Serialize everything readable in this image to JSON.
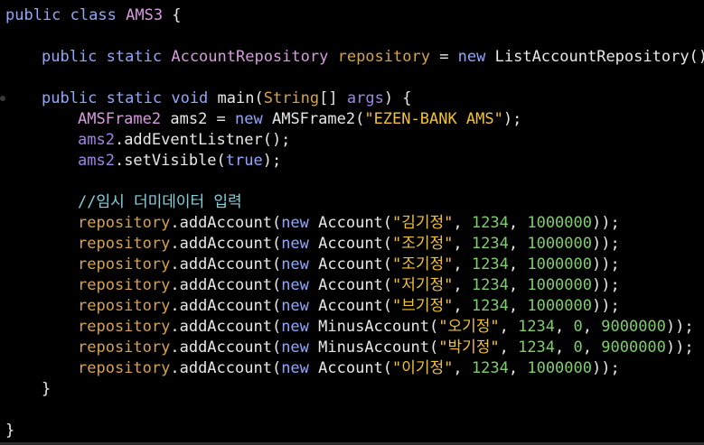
{
  "colors": {
    "background": "#000000",
    "plain": "#e8e8e8",
    "keyword": "#8fa7ff",
    "type": "#d99ae0",
    "field": "#d8a24b",
    "variable": "#9e86e6",
    "method": "#e6e6e6",
    "string": "#f2c230",
    "number": "#7ecf6b",
    "comment": "#80d4e0"
  },
  "icons": [
    "fold-marker-icon"
  ],
  "code_lines": [
    {
      "indent": 0,
      "tokens": [
        {
          "t": "public",
          "k": "keyword"
        },
        {
          "t": " ",
          "k": "plain"
        },
        {
          "t": "class",
          "k": "keyword"
        },
        {
          "t": " ",
          "k": "plain"
        },
        {
          "t": "AMS3",
          "k": "type"
        },
        {
          "t": " {",
          "k": "plain"
        }
      ]
    },
    {
      "indent": 0,
      "tokens": []
    },
    {
      "indent": 1,
      "tokens": [
        {
          "t": "public",
          "k": "keyword"
        },
        {
          "t": " ",
          "k": "plain"
        },
        {
          "t": "static",
          "k": "keyword"
        },
        {
          "t": " ",
          "k": "plain"
        },
        {
          "t": "AccountRepository",
          "k": "type"
        },
        {
          "t": " ",
          "k": "plain"
        },
        {
          "t": "repository",
          "k": "field"
        },
        {
          "t": " = ",
          "k": "plain"
        },
        {
          "t": "new",
          "k": "keyword"
        },
        {
          "t": " ListAccountRepository();",
          "k": "plain"
        }
      ]
    },
    {
      "indent": 0,
      "tokens": []
    },
    {
      "indent": 1,
      "fold": true,
      "tokens": [
        {
          "t": "public",
          "k": "keyword"
        },
        {
          "t": " ",
          "k": "plain"
        },
        {
          "t": "static",
          "k": "keyword"
        },
        {
          "t": " ",
          "k": "plain"
        },
        {
          "t": "void",
          "k": "keyword"
        },
        {
          "t": " main(",
          "k": "plain"
        },
        {
          "t": "String",
          "k": "field"
        },
        {
          "t": "[] ",
          "k": "plain"
        },
        {
          "t": "args",
          "k": "variable"
        },
        {
          "t": ") {",
          "k": "plain"
        }
      ]
    },
    {
      "indent": 2,
      "tokens": [
        {
          "t": "AMSFrame2",
          "k": "type"
        },
        {
          "t": " ams2 = ",
          "k": "plain"
        },
        {
          "t": "new",
          "k": "keyword"
        },
        {
          "t": " AMSFrame2(",
          "k": "plain"
        },
        {
          "t": "\"EZEN-BANK AMS\"",
          "k": "string"
        },
        {
          "t": ");",
          "k": "plain"
        }
      ]
    },
    {
      "indent": 2,
      "tokens": [
        {
          "t": "ams2",
          "k": "variable"
        },
        {
          "t": ".addEventListner();",
          "k": "plain"
        }
      ]
    },
    {
      "indent": 2,
      "tokens": [
        {
          "t": "ams2",
          "k": "variable"
        },
        {
          "t": ".setVisible(",
          "k": "plain"
        },
        {
          "t": "true",
          "k": "keyword"
        },
        {
          "t": ");",
          "k": "plain"
        }
      ]
    },
    {
      "indent": 0,
      "tokens": []
    },
    {
      "indent": 2,
      "tokens": [
        {
          "t": "//임시 더미데이터 입력",
          "k": "comment"
        }
      ]
    },
    {
      "indent": 2,
      "tokens": [
        {
          "t": "repository",
          "k": "field"
        },
        {
          "t": ".addAccount(",
          "k": "plain"
        },
        {
          "t": "new",
          "k": "keyword"
        },
        {
          "t": " Account(",
          "k": "plain"
        },
        {
          "t": "\"김기정\"",
          "k": "string"
        },
        {
          "t": ", ",
          "k": "plain"
        },
        {
          "t": "1234",
          "k": "number"
        },
        {
          "t": ", ",
          "k": "plain"
        },
        {
          "t": "1000000",
          "k": "number"
        },
        {
          "t": "));",
          "k": "plain"
        }
      ]
    },
    {
      "indent": 2,
      "tokens": [
        {
          "t": "repository",
          "k": "field"
        },
        {
          "t": ".addAccount(",
          "k": "plain"
        },
        {
          "t": "new",
          "k": "keyword"
        },
        {
          "t": " Account(",
          "k": "plain"
        },
        {
          "t": "\"조기정\"",
          "k": "string"
        },
        {
          "t": ", ",
          "k": "plain"
        },
        {
          "t": "1234",
          "k": "number"
        },
        {
          "t": ", ",
          "k": "plain"
        },
        {
          "t": "1000000",
          "k": "number"
        },
        {
          "t": "));",
          "k": "plain"
        }
      ]
    },
    {
      "indent": 2,
      "tokens": [
        {
          "t": "repository",
          "k": "field"
        },
        {
          "t": ".addAccount(",
          "k": "plain"
        },
        {
          "t": "new",
          "k": "keyword"
        },
        {
          "t": " Account(",
          "k": "plain"
        },
        {
          "t": "\"조기정\"",
          "k": "string"
        },
        {
          "t": ", ",
          "k": "plain"
        },
        {
          "t": "1234",
          "k": "number"
        },
        {
          "t": ", ",
          "k": "plain"
        },
        {
          "t": "1000000",
          "k": "number"
        },
        {
          "t": "));",
          "k": "plain"
        }
      ]
    },
    {
      "indent": 2,
      "tokens": [
        {
          "t": "repository",
          "k": "field"
        },
        {
          "t": ".addAccount(",
          "k": "plain"
        },
        {
          "t": "new",
          "k": "keyword"
        },
        {
          "t": " Account(",
          "k": "plain"
        },
        {
          "t": "\"저기정\"",
          "k": "string"
        },
        {
          "t": ", ",
          "k": "plain"
        },
        {
          "t": "1234",
          "k": "number"
        },
        {
          "t": ", ",
          "k": "plain"
        },
        {
          "t": "1000000",
          "k": "number"
        },
        {
          "t": "));",
          "k": "plain"
        }
      ]
    },
    {
      "indent": 2,
      "tokens": [
        {
          "t": "repository",
          "k": "field"
        },
        {
          "t": ".addAccount(",
          "k": "plain"
        },
        {
          "t": "new",
          "k": "keyword"
        },
        {
          "t": " Account(",
          "k": "plain"
        },
        {
          "t": "\"브기정\"",
          "k": "string"
        },
        {
          "t": ", ",
          "k": "plain"
        },
        {
          "t": "1234",
          "k": "number"
        },
        {
          "t": ", ",
          "k": "plain"
        },
        {
          "t": "1000000",
          "k": "number"
        },
        {
          "t": "));",
          "k": "plain"
        }
      ]
    },
    {
      "indent": 2,
      "tokens": [
        {
          "t": "repository",
          "k": "field"
        },
        {
          "t": ".addAccount(",
          "k": "plain"
        },
        {
          "t": "new",
          "k": "keyword"
        },
        {
          "t": " MinusAccount(",
          "k": "plain"
        },
        {
          "t": "\"오기정\"",
          "k": "string"
        },
        {
          "t": ", ",
          "k": "plain"
        },
        {
          "t": "1234",
          "k": "number"
        },
        {
          "t": ", ",
          "k": "plain"
        },
        {
          "t": "0",
          "k": "number"
        },
        {
          "t": ", ",
          "k": "plain"
        },
        {
          "t": "9000000",
          "k": "number"
        },
        {
          "t": "));",
          "k": "plain"
        }
      ]
    },
    {
      "indent": 2,
      "tokens": [
        {
          "t": "repository",
          "k": "field"
        },
        {
          "t": ".addAccount(",
          "k": "plain"
        },
        {
          "t": "new",
          "k": "keyword"
        },
        {
          "t": " MinusAccount(",
          "k": "plain"
        },
        {
          "t": "\"박기정\"",
          "k": "string"
        },
        {
          "t": ", ",
          "k": "plain"
        },
        {
          "t": "1234",
          "k": "number"
        },
        {
          "t": ", ",
          "k": "plain"
        },
        {
          "t": "0",
          "k": "number"
        },
        {
          "t": ", ",
          "k": "plain"
        },
        {
          "t": "9000000",
          "k": "number"
        },
        {
          "t": "));",
          "k": "plain"
        }
      ]
    },
    {
      "indent": 2,
      "tokens": [
        {
          "t": "repository",
          "k": "field"
        },
        {
          "t": ".addAccount(",
          "k": "plain"
        },
        {
          "t": "new",
          "k": "keyword"
        },
        {
          "t": " Account(",
          "k": "plain"
        },
        {
          "t": "\"이기정\"",
          "k": "string"
        },
        {
          "t": ", ",
          "k": "plain"
        },
        {
          "t": "1234",
          "k": "number"
        },
        {
          "t": ", ",
          "k": "plain"
        },
        {
          "t": "1000000",
          "k": "number"
        },
        {
          "t": "));",
          "k": "plain"
        }
      ]
    },
    {
      "indent": 1,
      "tokens": [
        {
          "t": "}",
          "k": "plain"
        }
      ]
    },
    {
      "indent": 0,
      "tokens": []
    },
    {
      "indent": 0,
      "tokens": [
        {
          "t": "}",
          "k": "plain"
        }
      ]
    }
  ]
}
